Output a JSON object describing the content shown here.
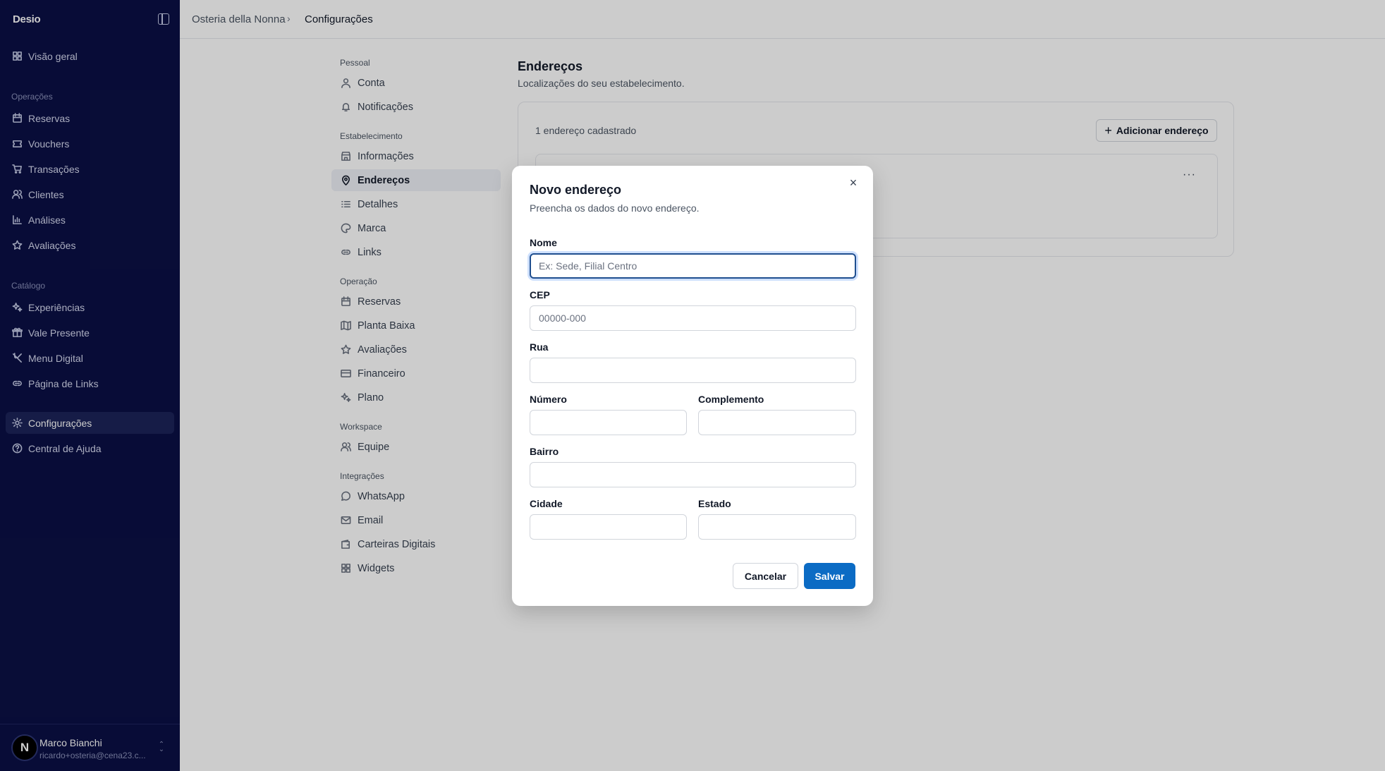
{
  "app": {
    "brand": "Desio"
  },
  "sidebar": {
    "items_top": [
      {
        "label": "Visão geral",
        "icon": "grid-icon"
      }
    ],
    "sections": [
      {
        "title": "Operações",
        "items": [
          {
            "label": "Reservas",
            "icon": "calendar-icon"
          },
          {
            "label": "Vouchers",
            "icon": "ticket-icon"
          },
          {
            "label": "Transações",
            "icon": "cart-icon"
          },
          {
            "label": "Clientes",
            "icon": "users-icon"
          },
          {
            "label": "Análises",
            "icon": "bar-chart-icon"
          },
          {
            "label": "Avaliações",
            "icon": "star-icon"
          }
        ]
      },
      {
        "title": "Catálogo",
        "items": [
          {
            "label": "Experiências",
            "icon": "sparkles-icon"
          },
          {
            "label": "Vale Presente",
            "icon": "gift-icon"
          },
          {
            "label": "Menu Digital",
            "icon": "utensils-icon"
          },
          {
            "label": "Página de Links",
            "icon": "link-icon"
          }
        ]
      }
    ],
    "items_bottom": [
      {
        "label": "Configurações",
        "icon": "gear-icon",
        "active": true
      },
      {
        "label": "Central de Ajuda",
        "icon": "help-icon"
      }
    ],
    "user": {
      "initial": "N",
      "name": "Marco Bianchi",
      "email": "ricardo+osteria@cena23.c..."
    }
  },
  "breadcrumb": {
    "parent": "Osteria della Nonna",
    "separator": "›",
    "current": "Configurações"
  },
  "settings_nav": {
    "groups": [
      {
        "title": "Pessoal",
        "items": [
          {
            "label": "Conta",
            "icon": "user-icon"
          },
          {
            "label": "Notificações",
            "icon": "bell-icon"
          }
        ]
      },
      {
        "title": "Estabelecimento",
        "items": [
          {
            "label": "Informações",
            "icon": "store-icon"
          },
          {
            "label": "Endereços",
            "icon": "map-pin-icon",
            "active": true
          },
          {
            "label": "Detalhes",
            "icon": "list-icon"
          },
          {
            "label": "Marca",
            "icon": "palette-icon"
          },
          {
            "label": "Links",
            "icon": "link-icon"
          }
        ]
      },
      {
        "title": "Operação",
        "items": [
          {
            "label": "Reservas",
            "icon": "calendar-icon"
          },
          {
            "label": "Planta Baixa",
            "icon": "map-icon"
          },
          {
            "label": "Avaliações",
            "icon": "star-icon"
          },
          {
            "label": "Financeiro",
            "icon": "credit-card-icon"
          },
          {
            "label": "Plano",
            "icon": "sparkles-icon"
          }
        ]
      },
      {
        "title": "Workspace",
        "items": [
          {
            "label": "Equipe",
            "icon": "users-icon"
          }
        ]
      },
      {
        "title": "Integrações",
        "items": [
          {
            "label": "WhatsApp",
            "icon": "whatsapp-icon"
          },
          {
            "label": "Email",
            "icon": "mail-icon"
          },
          {
            "label": "Carteiras Digitais",
            "icon": "wallet-icon"
          },
          {
            "label": "Widgets",
            "icon": "grid-icon"
          }
        ]
      }
    ]
  },
  "main": {
    "title": "Endereços",
    "subtitle": "Localizações do seu estabelecimento.",
    "count_label": "1 endereço cadastrado",
    "add_button": "Adicionar endereço",
    "more_label": "···"
  },
  "modal": {
    "title": "Novo endereço",
    "subtitle": "Preencha os dados do novo endereço.",
    "close": "×",
    "fields": {
      "nome": {
        "label": "Nome",
        "placeholder": "Ex: Sede, Filial Centro",
        "value": ""
      },
      "cep": {
        "label": "CEP",
        "placeholder": "00000-000",
        "value": ""
      },
      "rua": {
        "label": "Rua",
        "placeholder": "",
        "value": ""
      },
      "numero": {
        "label": "Número",
        "placeholder": "",
        "value": ""
      },
      "complemento": {
        "label": "Complemento",
        "placeholder": "",
        "value": ""
      },
      "bairro": {
        "label": "Bairro",
        "placeholder": "",
        "value": ""
      },
      "cidade": {
        "label": "Cidade",
        "placeholder": "",
        "value": ""
      },
      "estado": {
        "label": "Estado",
        "placeholder": "",
        "value": ""
      }
    },
    "cancel": "Cancelar",
    "save": "Salvar"
  },
  "colors": {
    "sidebar_bg": "#0b1045",
    "primary": "#0b6bc4",
    "focus_ring": "#1f4e8f"
  }
}
